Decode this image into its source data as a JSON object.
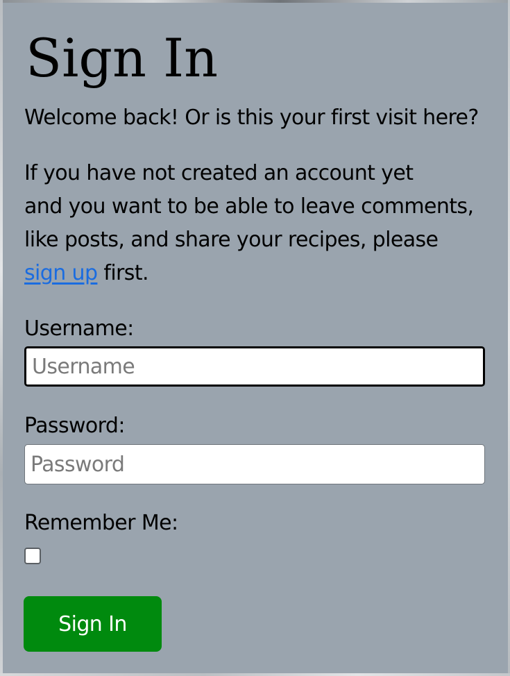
{
  "signin": {
    "title": "Sign In",
    "welcome": "Welcome back! Or is this your first visit here?",
    "info_line1": "If you have not created an account yet",
    "info_line2": "and you want to be able to leave comments,",
    "info_line3": "like posts, and share your recipes, please",
    "signup_link": "sign up",
    "info_tail": " first.",
    "username_label": "Username:",
    "username_placeholder": "Username",
    "username_value": "",
    "password_label": "Password:",
    "password_placeholder": "Password",
    "password_value": "",
    "remember_label": "Remember Me:",
    "remember_checked": false,
    "submit_label": "Sign In"
  },
  "colors": {
    "card_background": "#9aa4ae",
    "link": "#1a6ce0",
    "button_background": "#008a0e",
    "button_text": "#ffffff"
  }
}
